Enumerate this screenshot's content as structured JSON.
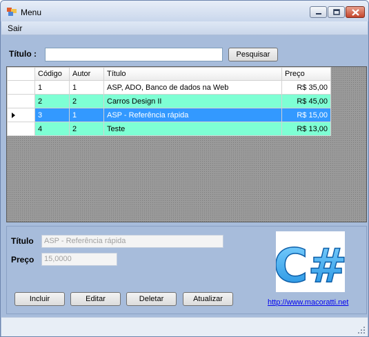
{
  "window": {
    "title": "Menu"
  },
  "menu": {
    "items": [
      "Sair"
    ]
  },
  "search": {
    "label": "Título :",
    "value": "",
    "button_label": "Pesquisar"
  },
  "grid": {
    "columns": [
      "Código",
      "Autor",
      "Título",
      "Preço"
    ],
    "rows": [
      {
        "codigo": "1",
        "autor": "1",
        "titulo": "ASP, ADO, Banco de dados na Web",
        "preco": "R$ 35,00"
      },
      {
        "codigo": "2",
        "autor": "2",
        "titulo": "Carros Design II",
        "preco": "R$ 45,00"
      },
      {
        "codigo": "3",
        "autor": "1",
        "titulo": "ASP - Referência rápida",
        "preco": "R$ 15,00"
      },
      {
        "codigo": "4",
        "autor": "2",
        "titulo": "Teste",
        "preco": "R$ 13,00"
      }
    ],
    "selected_row": 3
  },
  "details": {
    "titulo_label": "Título",
    "titulo_value": "ASP - Referência rápida",
    "preco_label": "Preço",
    "preco_value": "15,0000"
  },
  "actions": {
    "incluir": "Incluir",
    "editar": "Editar",
    "deletar": "Deletar",
    "atualizar": "Atualizar"
  },
  "logo": {
    "text": "C#"
  },
  "link": {
    "text": "http://www.macoratti.net"
  },
  "colors": {
    "row_green": "#7effd4",
    "row_selected": "#3399ff",
    "window_bg": "#a7bcdb"
  }
}
